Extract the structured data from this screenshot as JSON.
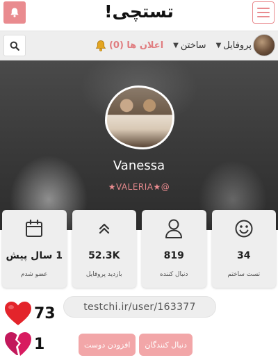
{
  "header": {
    "logo_text": "تستچی!",
    "bell_icon": "bell-icon",
    "menu_icon": "hamburger-icon",
    "accent_color": "#e98b8f"
  },
  "nav": {
    "items": [
      {
        "label": "پروفایل",
        "icon": "chevron-down-icon"
      },
      {
        "label": "ساختن",
        "icon": "chevron-down-icon"
      },
      {
        "label": "اعلان ها (0)",
        "icon": "bell-icon"
      }
    ],
    "search_icon": "search-icon"
  },
  "profile": {
    "name": "Vanessa",
    "handle": "★VALERIA★@"
  },
  "stats": [
    {
      "icon": "smiley-icon",
      "value": "34",
      "label": "تست ساختم"
    },
    {
      "icon": "user-icon",
      "value": "819",
      "label": "دنبال کننده"
    },
    {
      "icon": "double-chevron-up-icon",
      "value": "52.3K",
      "label": "بازدید پروفایل"
    },
    {
      "icon": "calendar-icon",
      "value": "1 سال پیش",
      "label": "عضو شدم"
    }
  ],
  "profile_url": "testchi.ir/user/163377",
  "reactions": {
    "likes": "73",
    "dislikes": "1"
  },
  "buttons": {
    "followers": "دنبال کنندگان",
    "add_friend": "افزودن دوست"
  }
}
